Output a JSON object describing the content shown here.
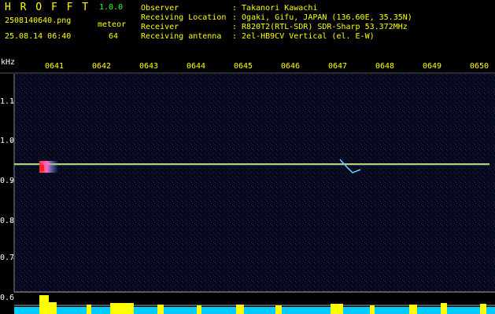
{
  "header": {
    "app_title": "H R O F F T",
    "app_version": "1.0.0",
    "filename": "2508140640.png",
    "datetime": "25.08.14 06:40",
    "meteor_label": "meteor",
    "meteor_count": "64",
    "info": [
      {
        "label": "Observer",
        "value": ": Takanori Kawachi"
      },
      {
        "label": "Receiving Location",
        "value": ": Ogaki, Gifu, JAPAN (136.60E, 35.35N)"
      },
      {
        "label": "Receiver",
        "value": ": R820T2(RTL-SDR) SDR-Sharp 53.372MHz"
      },
      {
        "label": "Receiving antenna",
        "value": ": 2el-HB9CV Vertical (el. E-W)"
      }
    ]
  },
  "spectrogram": {
    "unit_label": "kHz",
    "y_ticks": [
      "1.1",
      "1.0",
      "0.9",
      "0.8",
      "0.7",
      "0.6"
    ],
    "x_ticks": [
      "0641",
      "0642",
      "0643",
      "0644",
      "0645",
      "0646",
      "0647",
      "0648",
      "0649",
      "0650"
    ],
    "colors": {
      "signal": "#ffff66",
      "noise": "#1a2a66",
      "bar": "#00ccff",
      "bar_top": "#ffff00"
    }
  }
}
